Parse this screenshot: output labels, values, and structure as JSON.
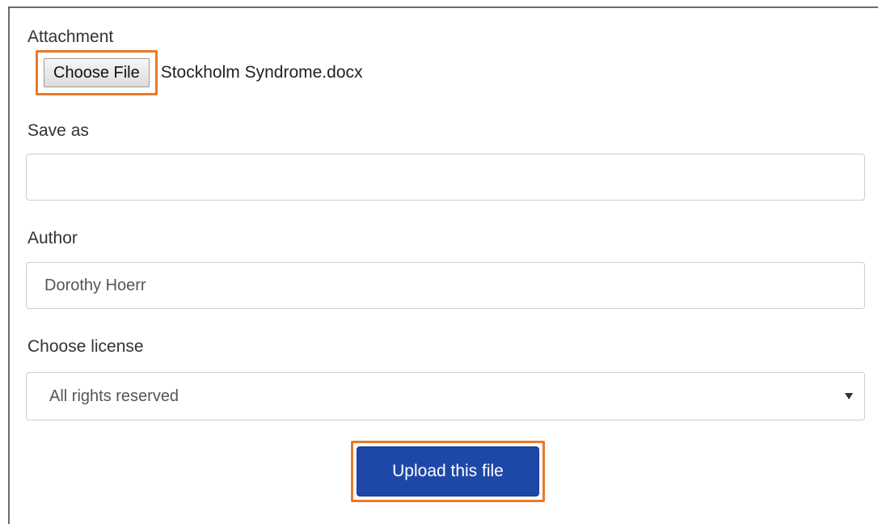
{
  "form": {
    "attachment": {
      "label": "Attachment",
      "button_label": "Choose File",
      "file_name": "Stockholm Syndrome.docx"
    },
    "save_as": {
      "label": "Save as",
      "value": ""
    },
    "author": {
      "label": "Author",
      "value": "Dorothy Hoerr"
    },
    "license": {
      "label": "Choose license",
      "selected": "All rights reserved"
    },
    "submit": {
      "label": "Upload this file"
    }
  },
  "colors": {
    "highlight": "#e8792a",
    "primary_button": "#1e48a8",
    "input_border": "#cccccc"
  },
  "icons": {
    "license_dropdown": "caret-down-icon"
  }
}
